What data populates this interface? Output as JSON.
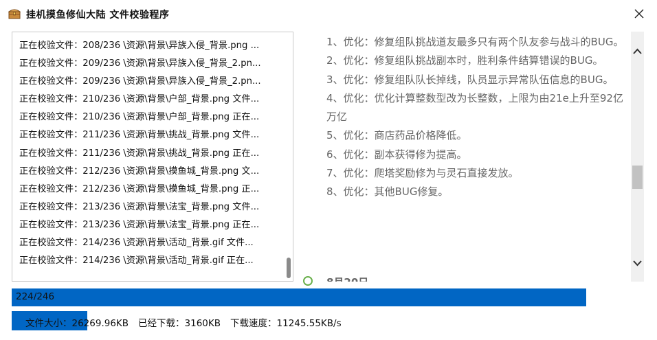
{
  "window": {
    "title": "挂机摸鱼修仙大陆 文件校验程序"
  },
  "icons": {
    "app": "treasure-chest-icon",
    "close": "close-icon",
    "scroll_up": "chevron-up-icon",
    "scroll_down": "chevron-down-icon"
  },
  "log": {
    "lines": [
      "正在校验文件：208/236 \\资源\\背景\\异族入侵_背景.png ...",
      "正在校验文件：209/236 \\资源\\背景\\异族入侵_背景_2.pn...",
      "正在校验文件：209/236 \\资源\\背景\\异族入侵_背景_2.pn...",
      "正在校验文件：210/236 \\资源\\背景\\户部_背景.png 文件...",
      "正在校验文件：210/236 \\资源\\背景\\户部_背景.png 正在...",
      "正在校验文件：211/236 \\资源\\背景\\挑战_背景.png 文件...",
      "正在校验文件：211/236 \\资源\\背景\\挑战_背景.png 正在...",
      "正在校验文件：212/236 \\资源\\背景\\摸鱼城_背景.png 文...",
      "正在校验文件：212/236 \\资源\\背景\\摸鱼城_背景.png 正...",
      "正在校验文件：213/236 \\资源\\背景\\法宝_背景.png 文件...",
      "正在校验文件：213/236 \\资源\\背景\\法宝_背景.png 正在...",
      "正在校验文件：214/236 \\资源\\背景\\活动_背景.gif 文件...",
      "正在校验文件：214/236 \\资源\\背景\\活动_背景.gif 正在..."
    ]
  },
  "notes": {
    "items": [
      "1、优化：修复组队挑战道友最多只有两个队友参与战斗的BUG。",
      "2、优化：修复组队挑战副本时，胜利条件结算错误的BUG。",
      "3、优化：修复组队队长掉线，队员显示异常队伍信息的BUG。",
      "4、优化：优化计算整数型改为长整数，上限为由21e上升至92亿万亿",
      "5、优化：商店药品价格降低。",
      "6、优化：副本获得修为提高。",
      "7、优化：爬塔奖励修为与灵石直接发放。",
      "8、优化：其他BUG修复。"
    ],
    "cut_heading": "8月20日"
  },
  "progress": {
    "text": "224/246",
    "fraction": 0.9106
  },
  "status": {
    "file_size": "文件大小：26269.96KB",
    "downloaded": "已经下载：3160KB",
    "speed": "下载速度：11245.55KB/s",
    "fraction": 0.12
  },
  "colors": {
    "accent": "#0166c4",
    "note_text": "#666666"
  }
}
